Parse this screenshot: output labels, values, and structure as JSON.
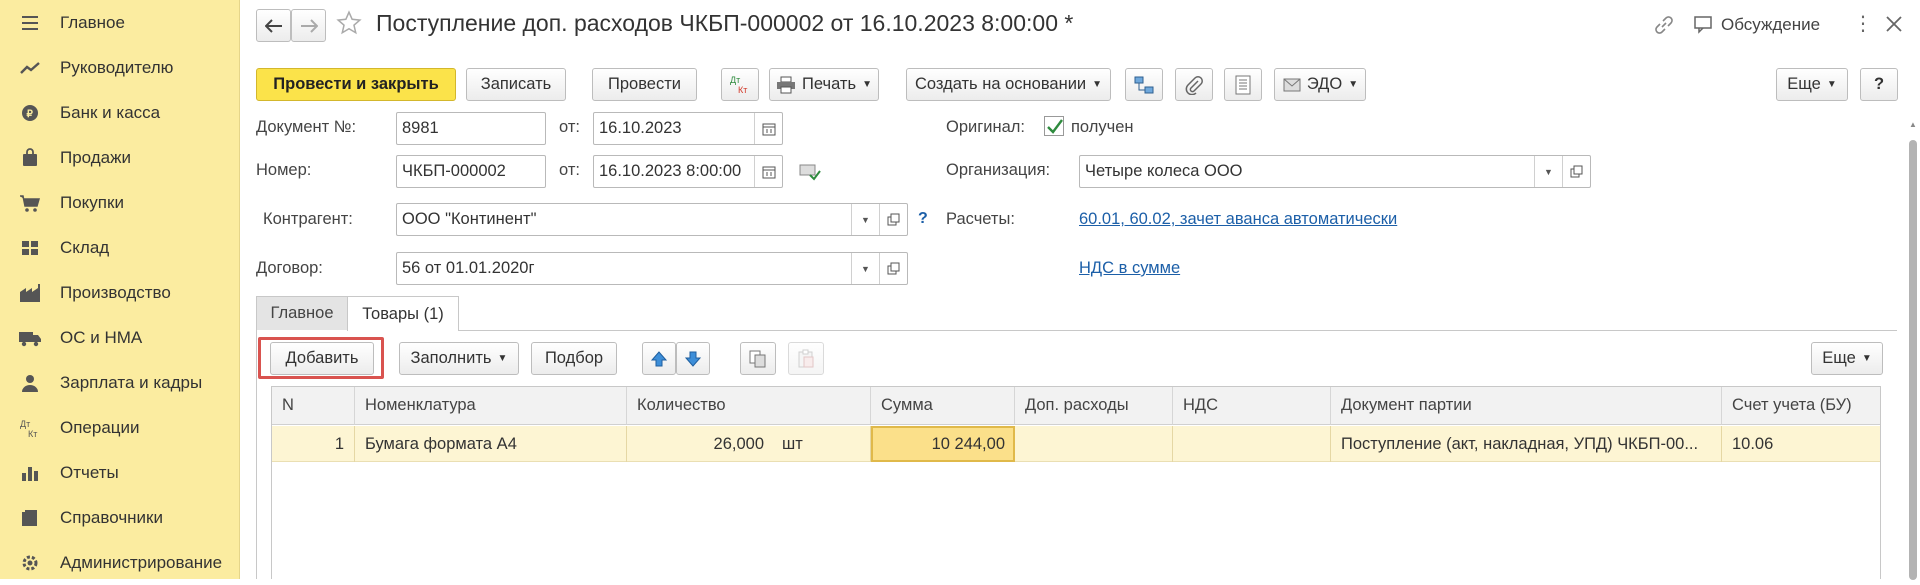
{
  "sidebar": {
    "items": [
      {
        "label": "Главное",
        "icon": "menu-icon"
      },
      {
        "label": "Руководителю",
        "icon": "trend-icon"
      },
      {
        "label": "Банк и касса",
        "icon": "coin-icon"
      },
      {
        "label": "Продажи",
        "icon": "bag-icon"
      },
      {
        "label": "Покупки",
        "icon": "cart-icon"
      },
      {
        "label": "Склад",
        "icon": "warehouse-icon"
      },
      {
        "label": "Производство",
        "icon": "factory-icon"
      },
      {
        "label": "ОС и НМА",
        "icon": "truck-icon"
      },
      {
        "label": "Зарплата и кадры",
        "icon": "person-icon"
      },
      {
        "label": "Операции",
        "icon": "dt-kt-icon"
      },
      {
        "label": "Отчеты",
        "icon": "bar-chart-icon"
      },
      {
        "label": "Справочники",
        "icon": "book-icon"
      },
      {
        "label": "Администрирование",
        "icon": "gear-icon"
      }
    ]
  },
  "header": {
    "title": "Поступление доп. расходов ЧКБП-000002 от 16.10.2023 8:00:00 *",
    "discussion": "Обсуждение"
  },
  "toolbar": {
    "post_close": "Провести и закрыть",
    "save": "Записать",
    "post": "Провести",
    "dtkt": "Дт Кт",
    "print": "Печать",
    "create_based": "Создать на основании",
    "edo": "ЭДО",
    "more": "Еще",
    "help": "?"
  },
  "form": {
    "doc_no_label": "Документ №:",
    "doc_no": "8981",
    "from_label": "от:",
    "doc_date": "16.10.2023",
    "number_label": "Номер:",
    "number": "ЧКБП-000002",
    "number_date": "16.10.2023  8:00:00",
    "original_label": "Оригинал:",
    "original_value": "получен",
    "org_label": "Организация:",
    "org": "Четыре колеса ООО",
    "counterparty_label": "Контрагент:",
    "counterparty": "ООО \"Континент\"",
    "help_q": "?",
    "settlements_label": "Расчеты:",
    "settlements_link": "60.01, 60.02, зачет аванса автоматически",
    "contract_label": "Договор:",
    "contract": "56 от 01.01.2020г",
    "vat_link": "НДС в сумме"
  },
  "tabs": [
    {
      "label": "Главное"
    },
    {
      "label": "Товары (1)"
    }
  ],
  "table_toolbar": {
    "add": "Добавить",
    "fill": "Заполнить",
    "pick": "Подбор",
    "more": "Еще"
  },
  "table": {
    "columns": [
      "N",
      "Номенклатура",
      "Количество",
      "Сумма",
      "Доп. расходы",
      "НДС",
      "Документ партии",
      "Счет учета (БУ)"
    ],
    "rows": [
      {
        "n": "1",
        "item": "Бумага формата А4",
        "qty": "26,000",
        "unit": "шт",
        "sum": "10 244,00",
        "extra": "",
        "vat": "",
        "batch": "Поступление (акт, накладная, УПД) ЧКБП-00...",
        "account": "10.06"
      }
    ]
  },
  "colors": {
    "sidebar_bg": "#fbeca0",
    "primary_button": "#fbe34a",
    "selected_row": "#fdf5d3",
    "highlight": "#d9534f",
    "link": "#1c5fa8"
  }
}
